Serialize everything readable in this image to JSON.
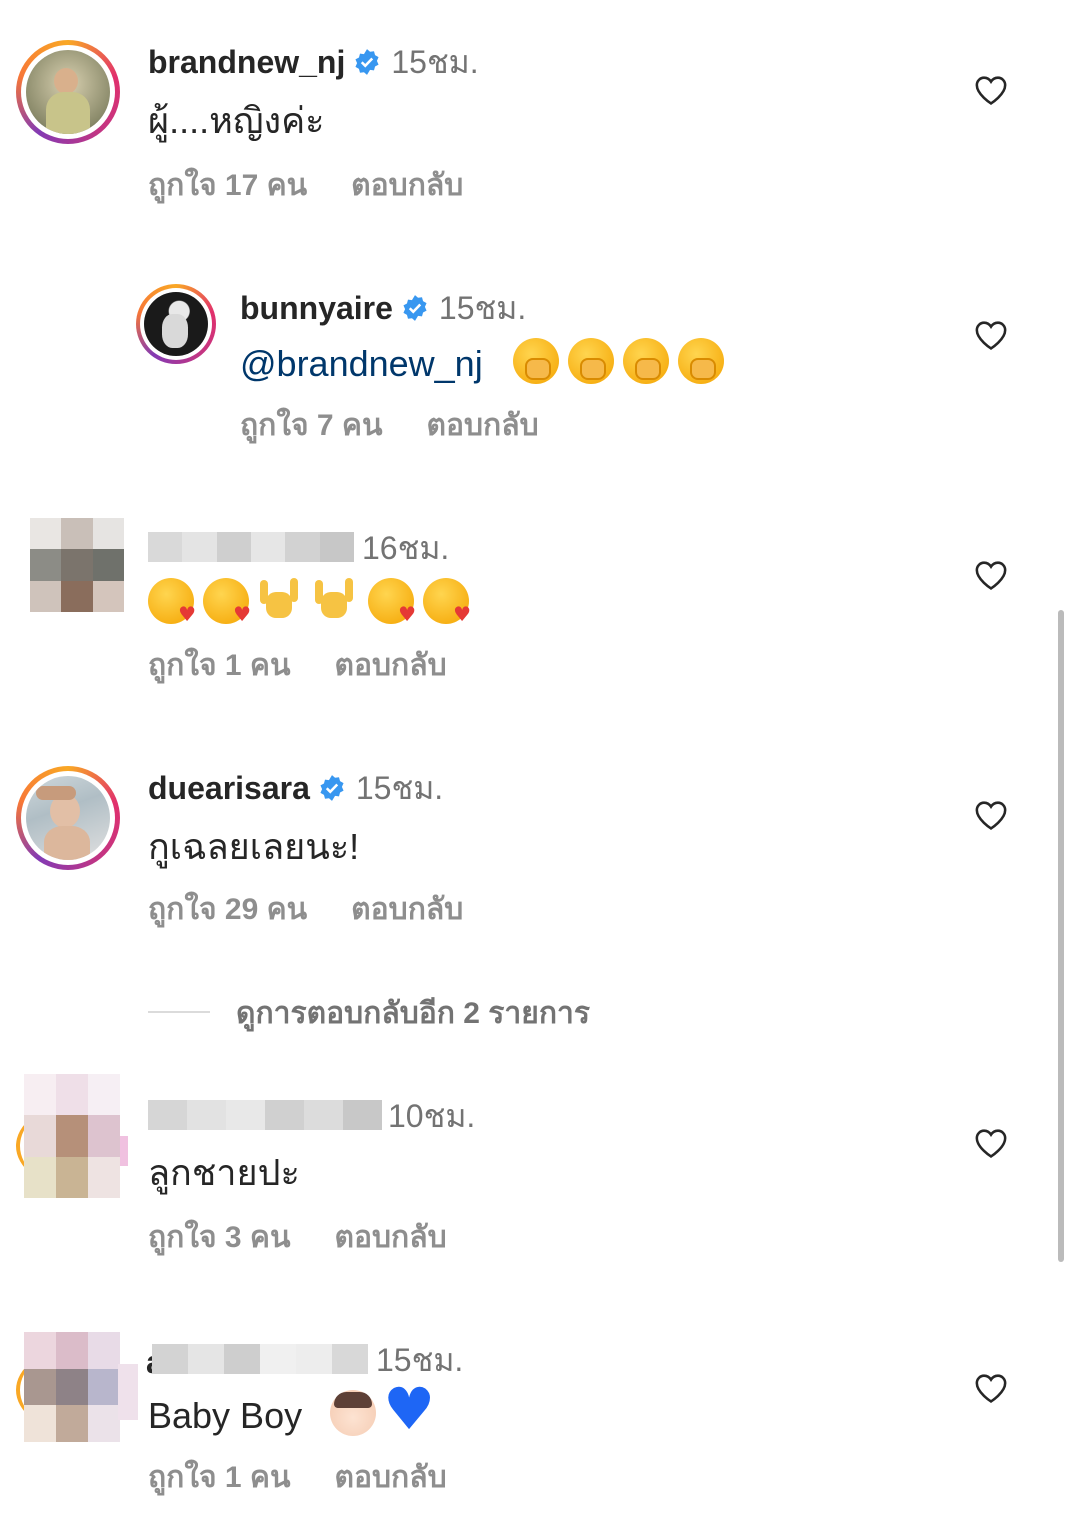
{
  "comments": [
    {
      "username": "brandnew_nj",
      "verified": true,
      "time": "15ชม.",
      "text": "ผู้....หญิงค่ะ",
      "likes": "ถูกใจ 17 คน",
      "reply": "ตอบกลับ"
    },
    {
      "username": "bunnyaire",
      "verified": true,
      "time": "15ชม.",
      "mention": "@brandnew_nj",
      "emojis": [
        "face-with-hand-over-mouth",
        "face-with-hand-over-mouth",
        "face-with-hand-over-mouth",
        "face-with-hand-over-mouth"
      ],
      "likes": "ถูกใจ 7 คน",
      "reply": "ตอบกลับ"
    },
    {
      "username": "",
      "time": "16ชม.",
      "emojis": [
        "face-blowing-kiss",
        "face-blowing-kiss",
        "sign-of-horns",
        "sign-of-horns",
        "face-blowing-kiss",
        "face-blowing-kiss"
      ],
      "likes": "ถูกใจ 1 คน",
      "reply": "ตอบกลับ"
    },
    {
      "username": "duearisara",
      "verified": true,
      "time": "15ชม.",
      "text": "กูเฉลยเลยนะ!",
      "likes": "ถูกใจ 29 คน",
      "reply": "ตอบกลับ"
    },
    {
      "username": "",
      "time": "10ชม.",
      "text": "ลูกชายปะ",
      "likes": "ถูกใจ 3 คน",
      "reply": "ตอบกลับ"
    },
    {
      "username_initial": "a",
      "time": "15ชม.",
      "text": "Baby Boy",
      "emojis": [
        "boy-light-skin",
        "blue-heart"
      ],
      "likes": "ถูกใจ 1 คน",
      "reply": "ตอบกลับ"
    }
  ],
  "view_more_replies": "ดูการตอบกลับอีก 2 รายการ",
  "colors": {
    "text": "#262626",
    "secondary": "#8e8e8e",
    "mention": "#00376b",
    "verified": "#3897f0"
  },
  "icons": {
    "like": "heart-outline-icon",
    "verified": "verified-badge-icon"
  }
}
